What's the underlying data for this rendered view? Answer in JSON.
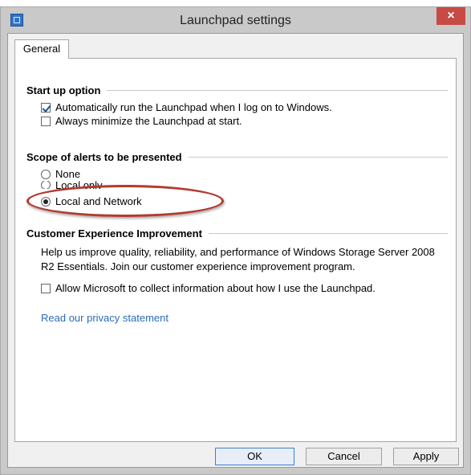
{
  "window": {
    "title": "Launchpad settings",
    "close_glyph": "×"
  },
  "tabs": [
    {
      "label": "General"
    }
  ],
  "startup": {
    "heading": "Start up option",
    "auto_run_label": "Automatically run the Launchpad when I log on to Windows.",
    "auto_run_checked": true,
    "minimize_label": "Always minimize the Launchpad at start.",
    "minimize_checked": false
  },
  "alerts": {
    "heading": "Scope of alerts to be presented",
    "options": [
      {
        "label": "None",
        "selected": false
      },
      {
        "label": "Local only",
        "selected": false
      },
      {
        "label": "Local and Network",
        "selected": true
      }
    ],
    "annotation_color": "#b23a2e"
  },
  "ceip": {
    "heading": "Customer Experience Improvement",
    "description": "Help us improve quality, reliability, and performance of Windows Storage Server 2008 R2 Essentials. Join our customer experience improvement program.",
    "allow_label": "Allow Microsoft to collect information about how I use the Launchpad.",
    "allow_checked": false,
    "privacy_link": "Read our privacy statement",
    "link_color": "#2a6bbd"
  },
  "buttons": {
    "ok": "OK",
    "cancel": "Cancel",
    "apply": "Apply"
  },
  "icons": {
    "app": "launchpad-app-icon",
    "close": "close-icon"
  }
}
